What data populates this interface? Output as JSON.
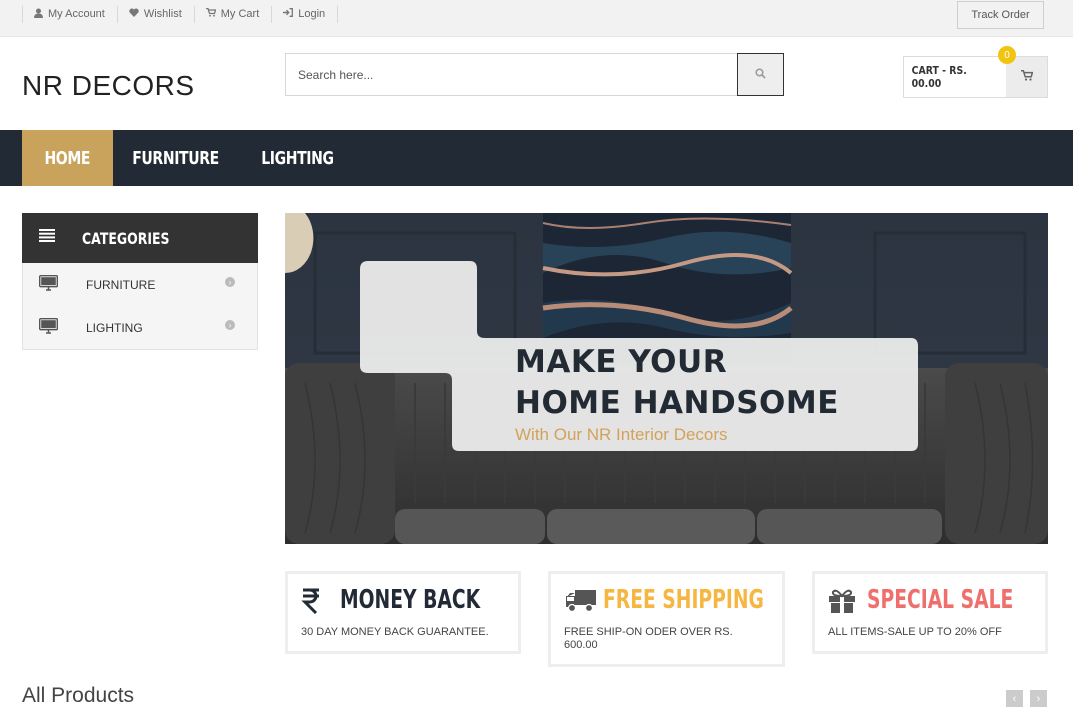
{
  "topbar": {
    "links": [
      {
        "label": "My Account",
        "icon": "user-icon"
      },
      {
        "label": "Wishlist",
        "icon": "heart-icon"
      },
      {
        "label": "My Cart",
        "icon": "cart-icon"
      },
      {
        "label": "Login",
        "icon": "login-icon"
      }
    ],
    "track_order": "Track Order"
  },
  "header": {
    "logo": "NR DECORS",
    "search_placeholder": "Search here...",
    "cart_label": "CART - RS. 00.00",
    "cart_count": "0"
  },
  "nav": {
    "items": [
      "HOME",
      "FURNITURE",
      "LIGHTING"
    ],
    "active_color": "#c9a25c"
  },
  "sidebar": {
    "title": "CATEGORIES",
    "items": [
      {
        "label": "FURNITURE",
        "icon": "monitor-icon"
      },
      {
        "label": "LIGHTING",
        "icon": "monitor-icon"
      }
    ]
  },
  "banner": {
    "line1": "MAKE YOUR",
    "line2": "HOME HANDSOME",
    "subtitle": "With Our NR Interior Decors"
  },
  "features": [
    {
      "title": "MONEY BACK",
      "desc": "30 DAY MONEY BACK GUARANTEE.",
      "icon": "rupee-icon",
      "color": "#222b35"
    },
    {
      "title": "FREE SHIPPING",
      "desc": "FREE SHIP-ON ODER OVER RS. 600.00",
      "icon": "truck-icon",
      "color": "#f6b642"
    },
    {
      "title": "SPECIAL SALE",
      "desc": "ALL ITEMS-SALE UP TO 20% OFF",
      "icon": "gift-icon",
      "color": "#ef6f6c"
    }
  ],
  "products": {
    "title": "All Products",
    "prev": "‹",
    "next": "›"
  }
}
